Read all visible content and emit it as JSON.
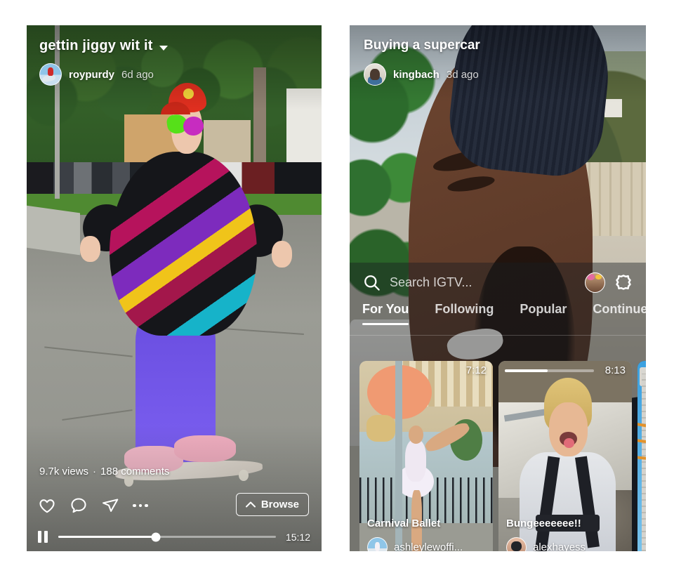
{
  "app": {
    "name": "IGTV"
  },
  "left_phone": {
    "video": {
      "title": "gettin jiggy wit it",
      "dropdown_icon": "chevron-down-icon",
      "username": "roypurdy",
      "time_ago": "6d ago",
      "views": "9.7k views",
      "separator": "·",
      "comments": "188 comments",
      "duration": "15:12",
      "progress_percent": 45
    },
    "actions": {
      "like_icon": "heart-icon",
      "comment_icon": "comment-bubble-icon",
      "share_icon": "paper-plane-icon",
      "more_icon": "ellipsis-icon",
      "browse_label": "Browse",
      "browse_icon": "chevron-up-icon",
      "pause_icon": "pause-icon"
    }
  },
  "right_phone": {
    "video": {
      "title": "Buying a supercar",
      "username": "kingbach",
      "time_ago": "3d ago"
    },
    "search": {
      "placeholder": "Search IGTV...",
      "icon": "search-icon"
    },
    "header_icons": {
      "profile": "profile-avatar",
      "settings": "gear-icon"
    },
    "tabs": [
      {
        "label": "For You",
        "active": true
      },
      {
        "label": "Following",
        "active": false
      },
      {
        "label": "Popular",
        "active": false
      },
      {
        "label": "Continue W",
        "active": false
      }
    ],
    "cards": [
      {
        "title": "Carnival Ballet",
        "username": "ashleylewoffi...",
        "duration": "7:12",
        "progress_percent": 0
      },
      {
        "title": "Bungeeeeeee!!",
        "username": "alexhayess",
        "duration": "8:13",
        "progress_percent": 48
      }
    ]
  },
  "colors": {
    "accent": "#ffffff",
    "page_background": "#ffffff",
    "overlay_dim": "#191c21"
  }
}
